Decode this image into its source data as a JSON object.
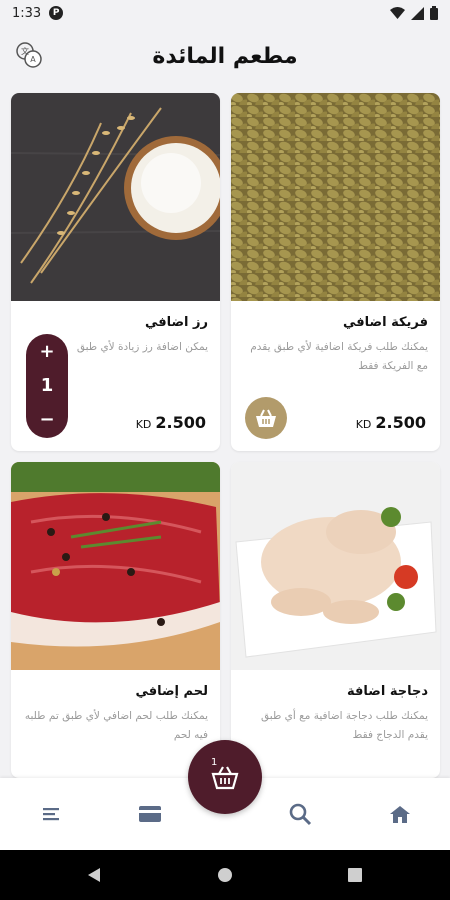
{
  "status_bar": {
    "time": "1:33",
    "notification_icon": "P"
  },
  "header": {
    "title": "مطعم المائدة",
    "translate_icon": "translate-icon"
  },
  "products": [
    {
      "name": "فريكة اضافي",
      "desc": "يمكنك طلب فريكة اضافية لأي طبق يقدم مع الفريكة فقط",
      "price": "2.500",
      "currency": "KD",
      "image": "freekeh"
    },
    {
      "name": "رز اضافي",
      "desc": "يمكن اضافة رز زيادة لأي طبق",
      "price": "2.500",
      "currency": "KD",
      "image": "rice",
      "quantity": "1"
    },
    {
      "name": "دجاجة اضافة",
      "desc": "يمكنك طلب دجاجة اضافية مع أي طبق يقدم الدجاج فقط",
      "image": "chicken"
    },
    {
      "name": "لحم إضافي",
      "desc": "يمكنك طلب لحم اضافي لأي طبق تم طلبه فيه لحم",
      "image": "meat"
    }
  ],
  "stepper": {
    "plus": "+",
    "quantity": "1",
    "minus": "−"
  },
  "cart": {
    "count": "1"
  },
  "colors": {
    "primary": "#4f1c2b",
    "accent": "#b29b6b"
  }
}
